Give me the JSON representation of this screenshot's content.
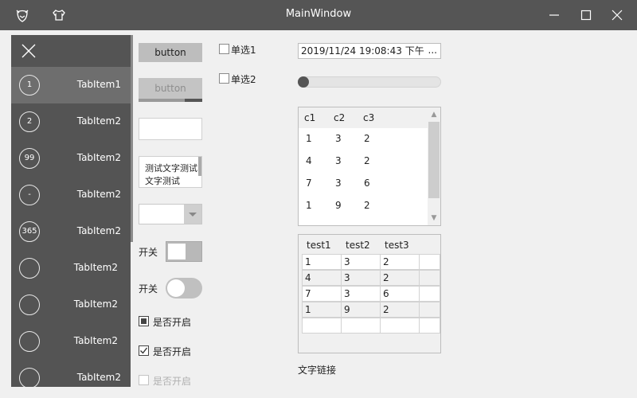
{
  "window": {
    "title": "MainWindow"
  },
  "tabs": [
    {
      "badge": "1",
      "label": "TabItem1"
    },
    {
      "badge": "2",
      "label": "TabItem2"
    },
    {
      "badge": "99",
      "label": "TabItem2"
    },
    {
      "badge": "-",
      "label": "TabItem2"
    },
    {
      "badge": "365",
      "label": "TabItem2"
    },
    {
      "badge": "",
      "label": "TabItem2"
    },
    {
      "badge": "",
      "label": "TabItem2"
    },
    {
      "badge": "",
      "label": "TabItem2"
    },
    {
      "badge": "",
      "label": "TabItem2"
    }
  ],
  "controls": {
    "button1": "button",
    "button2": "button",
    "multiline_text": "测试文字测试文字测试",
    "switch_label": "开关",
    "check1": "是否开启",
    "check2": "是否开启",
    "check3": "是否开启",
    "radio1": "单选1",
    "radio2": "单选2"
  },
  "datetime": {
    "value": "2019/11/24 19:08:43 下午",
    "more": "..."
  },
  "slider": {
    "value": 0
  },
  "listview": {
    "columns": [
      "c1",
      "c2",
      "c3"
    ],
    "rows": [
      [
        "1",
        "3",
        "2"
      ],
      [
        "4",
        "3",
        "2"
      ],
      [
        "7",
        "3",
        "6"
      ],
      [
        "1",
        "9",
        "2"
      ]
    ]
  },
  "datagrid": {
    "columns": [
      "test1",
      "test2",
      "test3"
    ],
    "rows": [
      [
        "1",
        "3",
        "2"
      ],
      [
        "4",
        "3",
        "2"
      ],
      [
        "7",
        "3",
        "6"
      ],
      [
        "1",
        "9",
        "2"
      ],
      [
        "",
        "",
        ""
      ]
    ]
  },
  "link_text": "文字链接",
  "colors": {
    "titlebar": "#555555",
    "tab_panel": "#545454",
    "tab_selected": "#6e6e6e"
  },
  "icons": [
    "app-icon",
    "shirt-icon",
    "minimize-icon",
    "maximize-icon",
    "close-icon"
  ]
}
